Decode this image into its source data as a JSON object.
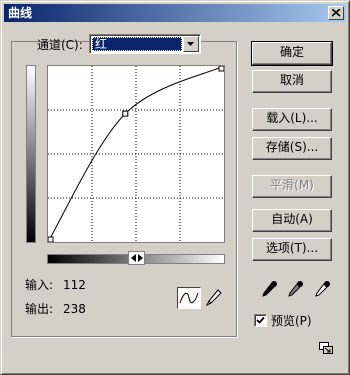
{
  "window": {
    "title": "曲线"
  },
  "channel": {
    "label": "通道(C):",
    "selected": "红"
  },
  "readout": {
    "input_label": "输入:",
    "input_value": "112",
    "output_label": "输出:",
    "output_value": "238"
  },
  "buttons": {
    "ok": "确定",
    "cancel": "取消",
    "load": "载入(L)...",
    "save": "存储(S)...",
    "smooth": "平滑(M)",
    "auto": "自动(A)",
    "options": "选项(T)..."
  },
  "preview": {
    "label": "预览(P)",
    "checked": true
  },
  "curve": {
    "x_range": [
      0,
      255
    ],
    "y_range": [
      0,
      255
    ],
    "points": [
      [
        0,
        0
      ],
      [
        112,
        186
      ],
      [
        255,
        255
      ]
    ],
    "grid_divisions": 4
  },
  "colors": {
    "title_bar_start": "#0a246a",
    "title_bar_end": "#a6caf0",
    "dialog_face": "#d4d0c8",
    "selection": "#0a246a"
  },
  "icons": [
    "close-icon",
    "dropdown-arrow-icon",
    "gradient-toggle-icon",
    "curve-tool-icon",
    "pencil-tool-icon",
    "black-eyedropper-icon",
    "gray-eyedropper-icon",
    "white-eyedropper-icon",
    "check-icon",
    "expand-icon"
  ]
}
